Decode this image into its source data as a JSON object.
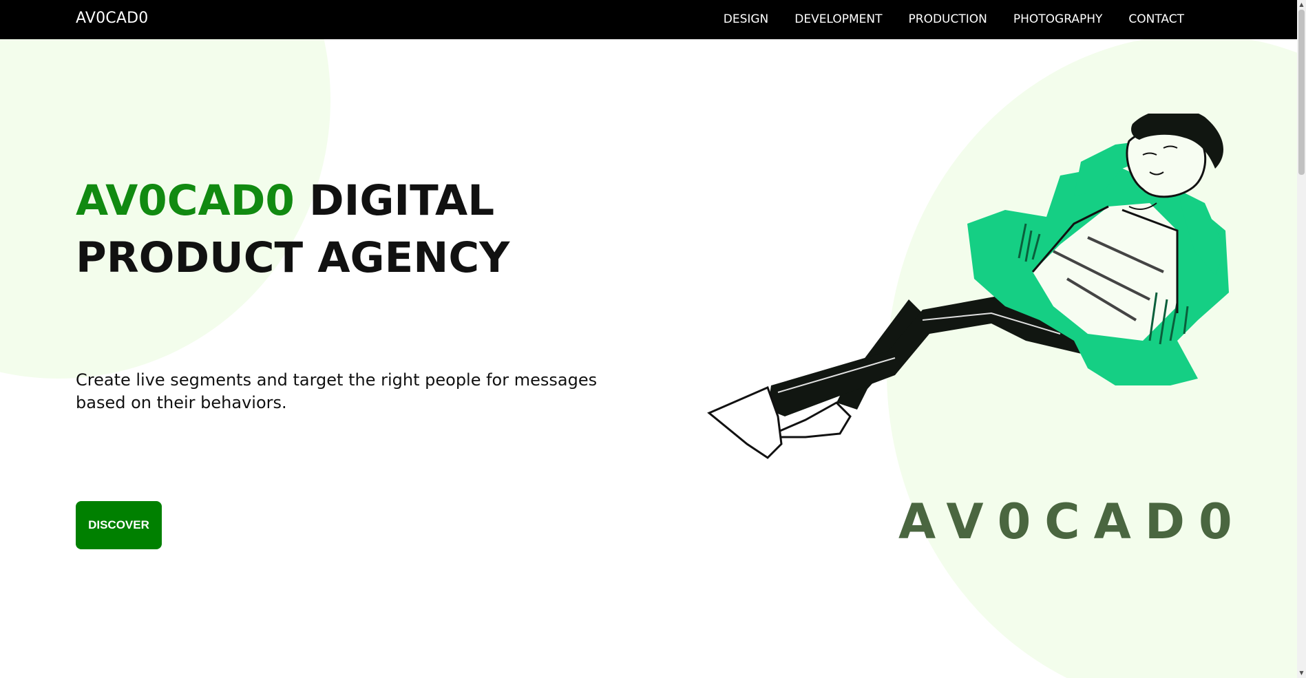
{
  "navbar": {
    "brand": "AV0CAD0",
    "links": [
      "DESIGN",
      "DEVELOPMENT",
      "PRODUCTION",
      "PHOTOGRAPHY",
      "CONTACT"
    ]
  },
  "hero": {
    "title_accent": "AV0CAD0",
    "title_rest_line1": "DIGITAL",
    "title_line2": "PRODUCT AGENCY",
    "subtitle": "Create live segments and target the right people for messages based on their behaviors.",
    "cta_label": "DISCOVER"
  },
  "illustration": {
    "logo_text": "AV0CAD0",
    "subject": "relaxing-man-illustration"
  },
  "colors": {
    "accent_green": "#118a11",
    "button_green": "#008000",
    "jacket_green": "#15cf84",
    "blob_mint": "#f3fdec",
    "logo_green": "#4a6640",
    "nav_bg": "#000000"
  }
}
